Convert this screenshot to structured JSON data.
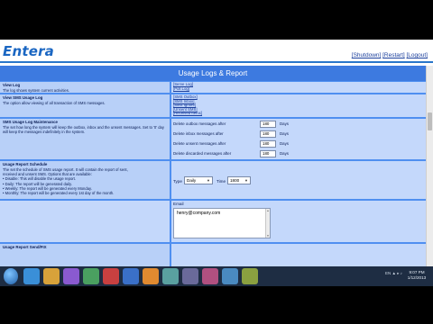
{
  "brand": "Entera",
  "top_links": [
    "[Shutdown]",
    "[Restart]",
    "[Logout]"
  ],
  "panel_title": "Usage Logs & Report",
  "sections": {
    "view_log": {
      "title": "View Log",
      "desc": "The log shows system current activities.",
      "links": [
        "[Serve Log]",
        "[Poll Log]"
      ]
    },
    "view_sms": {
      "title": "View SMS Usage Log",
      "desc": "The option allow viewing of all transaction of SMS messages.",
      "links": [
        "[SMS Outbox]",
        "[SMS Inbox]",
        "[SMS Ignore]",
        "[Unsent SMS]",
        "[Received Items]"
      ]
    },
    "maintenance": {
      "title": "SMS Usage Log Maintenance",
      "desc": "The set how long the system will keep the outbox, inbox and the unsent messages. Set to '0' day will keep the messages indefinitely in the system.",
      "rows": [
        {
          "label": "Delete outbox messages after",
          "value": "180",
          "unit": "Days"
        },
        {
          "label": "Delete inbox messages after",
          "value": "180",
          "unit": "Days"
        },
        {
          "label": "Delete unsent messages after",
          "value": "180",
          "unit": "Days"
        },
        {
          "label": "Delete discarded messages after",
          "value": "180",
          "unit": "Days"
        }
      ]
    },
    "schedule": {
      "title": "Usage Report Schedule",
      "desc_lines": [
        "The set the schedule of SMS usage report. It will contain the report of sent,",
        "received and unsent SMS. Options that are available:",
        "• Disable: This will disable the usage report.",
        "• Daily: The report will be generated daily.",
        "• Weekly: The report will be generated every Monday.",
        "• Monthly: The report will be generated every 1st day of the month."
      ],
      "type_label": "Type",
      "type_value": "Daily",
      "time_label": "Time",
      "time_value": "1800"
    },
    "email": {
      "label": "Email",
      "value": "henry@company.com"
    },
    "footer_title": "Usage Report Send/FIX"
  },
  "taskbar": {
    "tray_text": "EN  ▲  ▸  ♪",
    "clock_time": "9:07 PM",
    "clock_date": "1/12/2013"
  },
  "colors": {
    "brand_blue": "#1a66c2",
    "panel_blue": "#4f8ff0",
    "cell_blue": "#b8d0f8",
    "taskbar": "#1e2d43"
  }
}
